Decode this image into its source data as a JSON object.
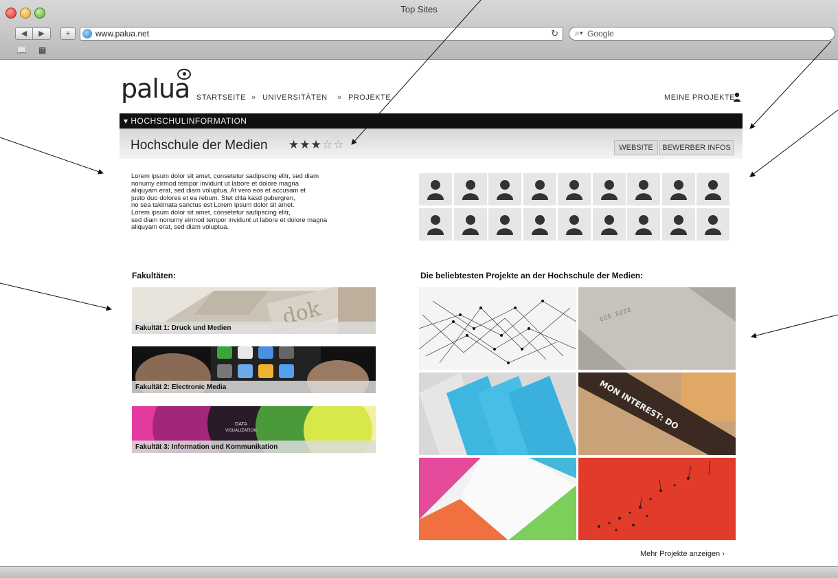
{
  "browser": {
    "window_title": "Top Sites",
    "url": "www.palua.net",
    "search_placeholder": "Google"
  },
  "site": {
    "logo": "palua",
    "nav": [
      "STARTSEITE",
      "UNIVERSITÄTEN",
      "PROJEKTE"
    ],
    "nav_separator": "»",
    "my_projects": "MEINE PROJEKTE",
    "section_bar": "▾ HOCHSCHULINFORMATION",
    "school_name": "Hochschule der Medien",
    "rating": 3,
    "rating_max": 5,
    "buttons": {
      "website": "WEBSITE",
      "applicant_info": "BEWERBER INFOS"
    },
    "description": "Lorem ipsum dolor sit amet, consetetur sadipscing elitr, sed diam\nnonumy eirmod tempor invidunt ut labore et dolore magna\naliquyam erat, sed diam voluptua. At vero eos et accusam et\njusto duo dolores et ea rebum. Stet clita kasd gubergren,\nno sea takimata sanctus est Lorem ipsum dolor sit amet.\nLorem ipsum dolor sit amet, consetetur sadipscing elitr,\nsed diam nonumy eirmod tempor invidunt ut labore et dolore magna\naliquyam erat, sed diam voluptua.",
    "faculties_heading": "Fakultäten:",
    "faculties": [
      "Fakultät 1: Druck und Medien",
      "Fakultät 2: Electronic Media",
      "Fakultät 3: Information und Kommunikation"
    ],
    "projects_heading": "Die beliebtesten Projekte an der Hochschule der Medien:",
    "more_projects": "Mehr Projekte anzeigen ›",
    "project_images": [
      "network-visualization",
      "grey-paper-print",
      "blue-pattern-booklets",
      "common-interest-book",
      "colorful-triangles",
      "red-dandelion-poster"
    ],
    "colors": {
      "black_bar": "#111111",
      "accent_red": "#e23b2a"
    }
  }
}
